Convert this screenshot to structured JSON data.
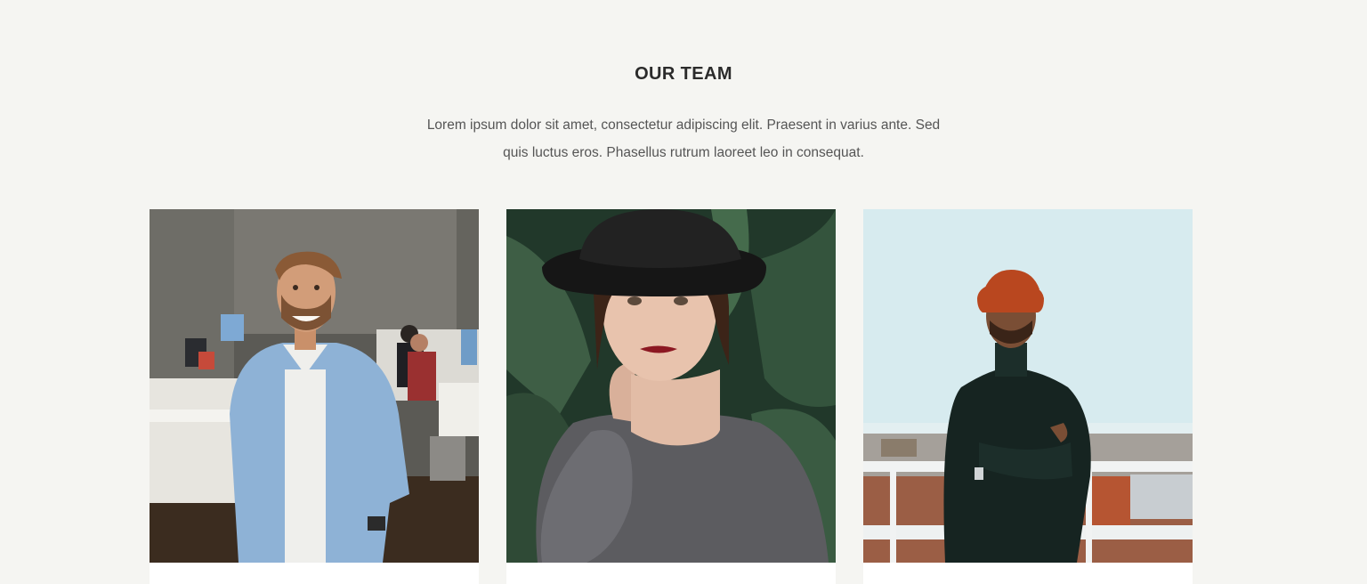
{
  "team": {
    "title": "OUR TEAM",
    "intro": "Lorem ipsum dolor sit amet, consectetur adipiscing elit. Praesent in varius ante. Sed quis luctus eros. Phasellus rutrum laoreet leo in consequat."
  },
  "members": [
    {
      "photo": "man-office-portrait",
      "accent": "#7aa3c9"
    },
    {
      "photo": "woman-hat-portrait",
      "accent": "#2f4a33"
    },
    {
      "photo": "man-beanie-portrait",
      "accent": "#c15a2c"
    }
  ]
}
